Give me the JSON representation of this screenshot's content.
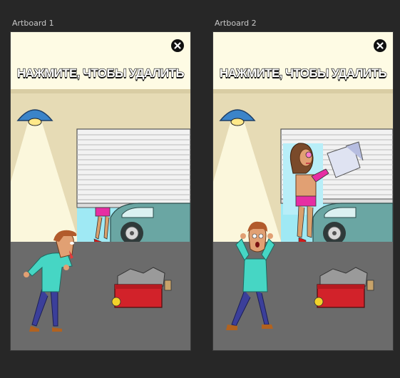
{
  "artboards": [
    {
      "label": "Artboard 1",
      "banner_text": "НАЖМИТЕ, ЧТОБЫ УДАЛИТЬ",
      "close_icon": "close-icon",
      "scene": "man-walking-toward-garage"
    },
    {
      "label": "Artboard 2",
      "banner_text": "НАЖМИТЕ, ЧТОБЫ УДАЛИТЬ",
      "close_icon": "close-icon",
      "scene": "man-shocked-woman-with-hairdryer"
    }
  ],
  "colors": {
    "background": "#272727",
    "banner": "#fefbe4",
    "wall": "#e6dbb5",
    "floor": "#6b6b6b",
    "lamp": "#3b84c9",
    "car": "#6aa6a3",
    "toolbox": "#d2222a",
    "shirt": "#46d6c4",
    "pants": "#3b3f9a"
  }
}
